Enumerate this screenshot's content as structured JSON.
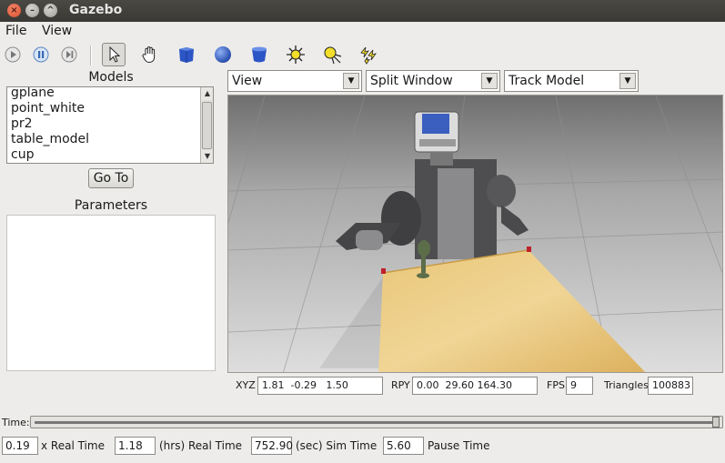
{
  "window": {
    "title": "Gazebo",
    "close_glyph": "×",
    "min_glyph": "–",
    "max_glyph": "^"
  },
  "menu": {
    "file": "File",
    "view": "View"
  },
  "toolbar": {
    "icons": [
      "play-icon",
      "pause-icon",
      "step-icon",
      "select-arrow-icon",
      "hand-icon",
      "box-icon",
      "sphere-icon",
      "cylinder-icon",
      "point-light-icon",
      "spot-light-icon",
      "directional-light-icon"
    ],
    "selected_tool": "select-arrow-icon"
  },
  "models": {
    "heading": "Models",
    "items": [
      "gplane",
      "point_white",
      "pr2",
      "table_model",
      "cup"
    ],
    "goto_label": "Go To"
  },
  "parameters": {
    "heading": "Parameters"
  },
  "view_controls": {
    "view_select": "View",
    "split_select": "Split Window",
    "track_select": "Track Model",
    "arrow": "▼"
  },
  "status": {
    "xyz_label": "XYZ",
    "xyz_value": "1.81  -0.29   1.50",
    "rpy_label": "RPY",
    "rpy_value": "0.00  29.60 164.30",
    "fps_label": "FPS",
    "fps_value": "9",
    "triangles_label": "Triangles",
    "triangles_value": "100883"
  },
  "time": {
    "label": "Time:",
    "slider_position": 1.0,
    "real_time_factor": "0.19",
    "real_time_factor_label": "x Real Time",
    "real_time_hrs": "1.18",
    "real_time_hrs_label": "(hrs) Real Time",
    "sim_time_sec": "752.90",
    "sim_time_label": "(sec) Sim Time",
    "pause_time": "5.60",
    "pause_time_label": "Pause Time"
  },
  "colors": {
    "accent_blue": "#3b5fbf",
    "light_yellow": "#f2de2a",
    "table_wood": "#e2b862"
  }
}
